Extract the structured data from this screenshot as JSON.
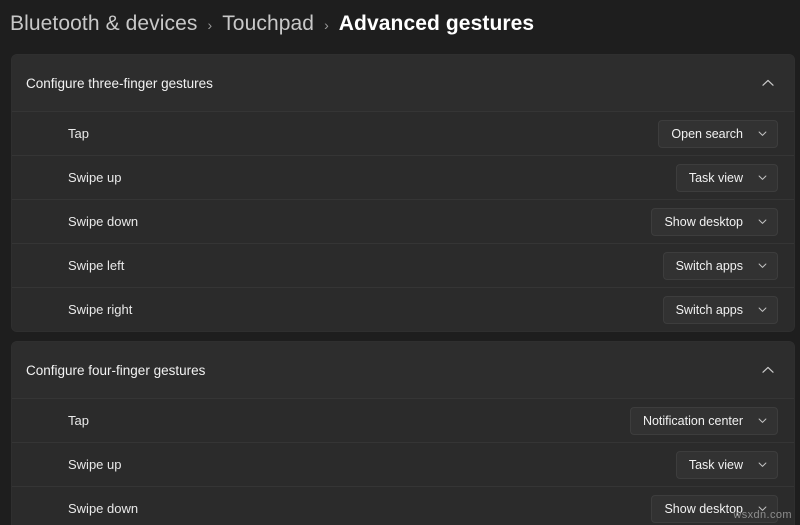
{
  "breadcrumb": {
    "separator_icon": "chevron-right-icon",
    "items": [
      {
        "label": "Bluetooth & devices",
        "current": false
      },
      {
        "label": "Touchpad",
        "current": false
      },
      {
        "label": "Advanced gestures",
        "current": true
      }
    ]
  },
  "sections": [
    {
      "title": "Configure three-finger gestures",
      "collapse_icon": "chevron-up-icon",
      "expanded": true,
      "rows": [
        {
          "label": "Tap",
          "value": "Open search",
          "dropdown_icon": "chevron-down-icon"
        },
        {
          "label": "Swipe up",
          "value": "Task view",
          "dropdown_icon": "chevron-down-icon"
        },
        {
          "label": "Swipe down",
          "value": "Show desktop",
          "dropdown_icon": "chevron-down-icon"
        },
        {
          "label": "Swipe left",
          "value": "Switch apps",
          "dropdown_icon": "chevron-down-icon"
        },
        {
          "label": "Swipe right",
          "value": "Switch apps",
          "dropdown_icon": "chevron-down-icon"
        }
      ]
    },
    {
      "title": "Configure four-finger gestures",
      "collapse_icon": "chevron-up-icon",
      "expanded": true,
      "rows": [
        {
          "label": "Tap",
          "value": "Notification center",
          "dropdown_icon": "chevron-down-icon"
        },
        {
          "label": "Swipe up",
          "value": "Task view",
          "dropdown_icon": "chevron-down-icon"
        },
        {
          "label": "Swipe down",
          "value": "Show desktop",
          "dropdown_icon": "chevron-down-icon"
        }
      ]
    }
  ],
  "watermark": {
    "text": "wsxdn.com"
  },
  "colors": {
    "page_background": "#1e1e1e",
    "card_background": "#2b2b2b",
    "card_header_background": "#2d2d2d",
    "dropdown_background": "#323232",
    "separator": "#353535",
    "text_primary": "#ffffff",
    "text_secondary": "#c8c8c8"
  }
}
